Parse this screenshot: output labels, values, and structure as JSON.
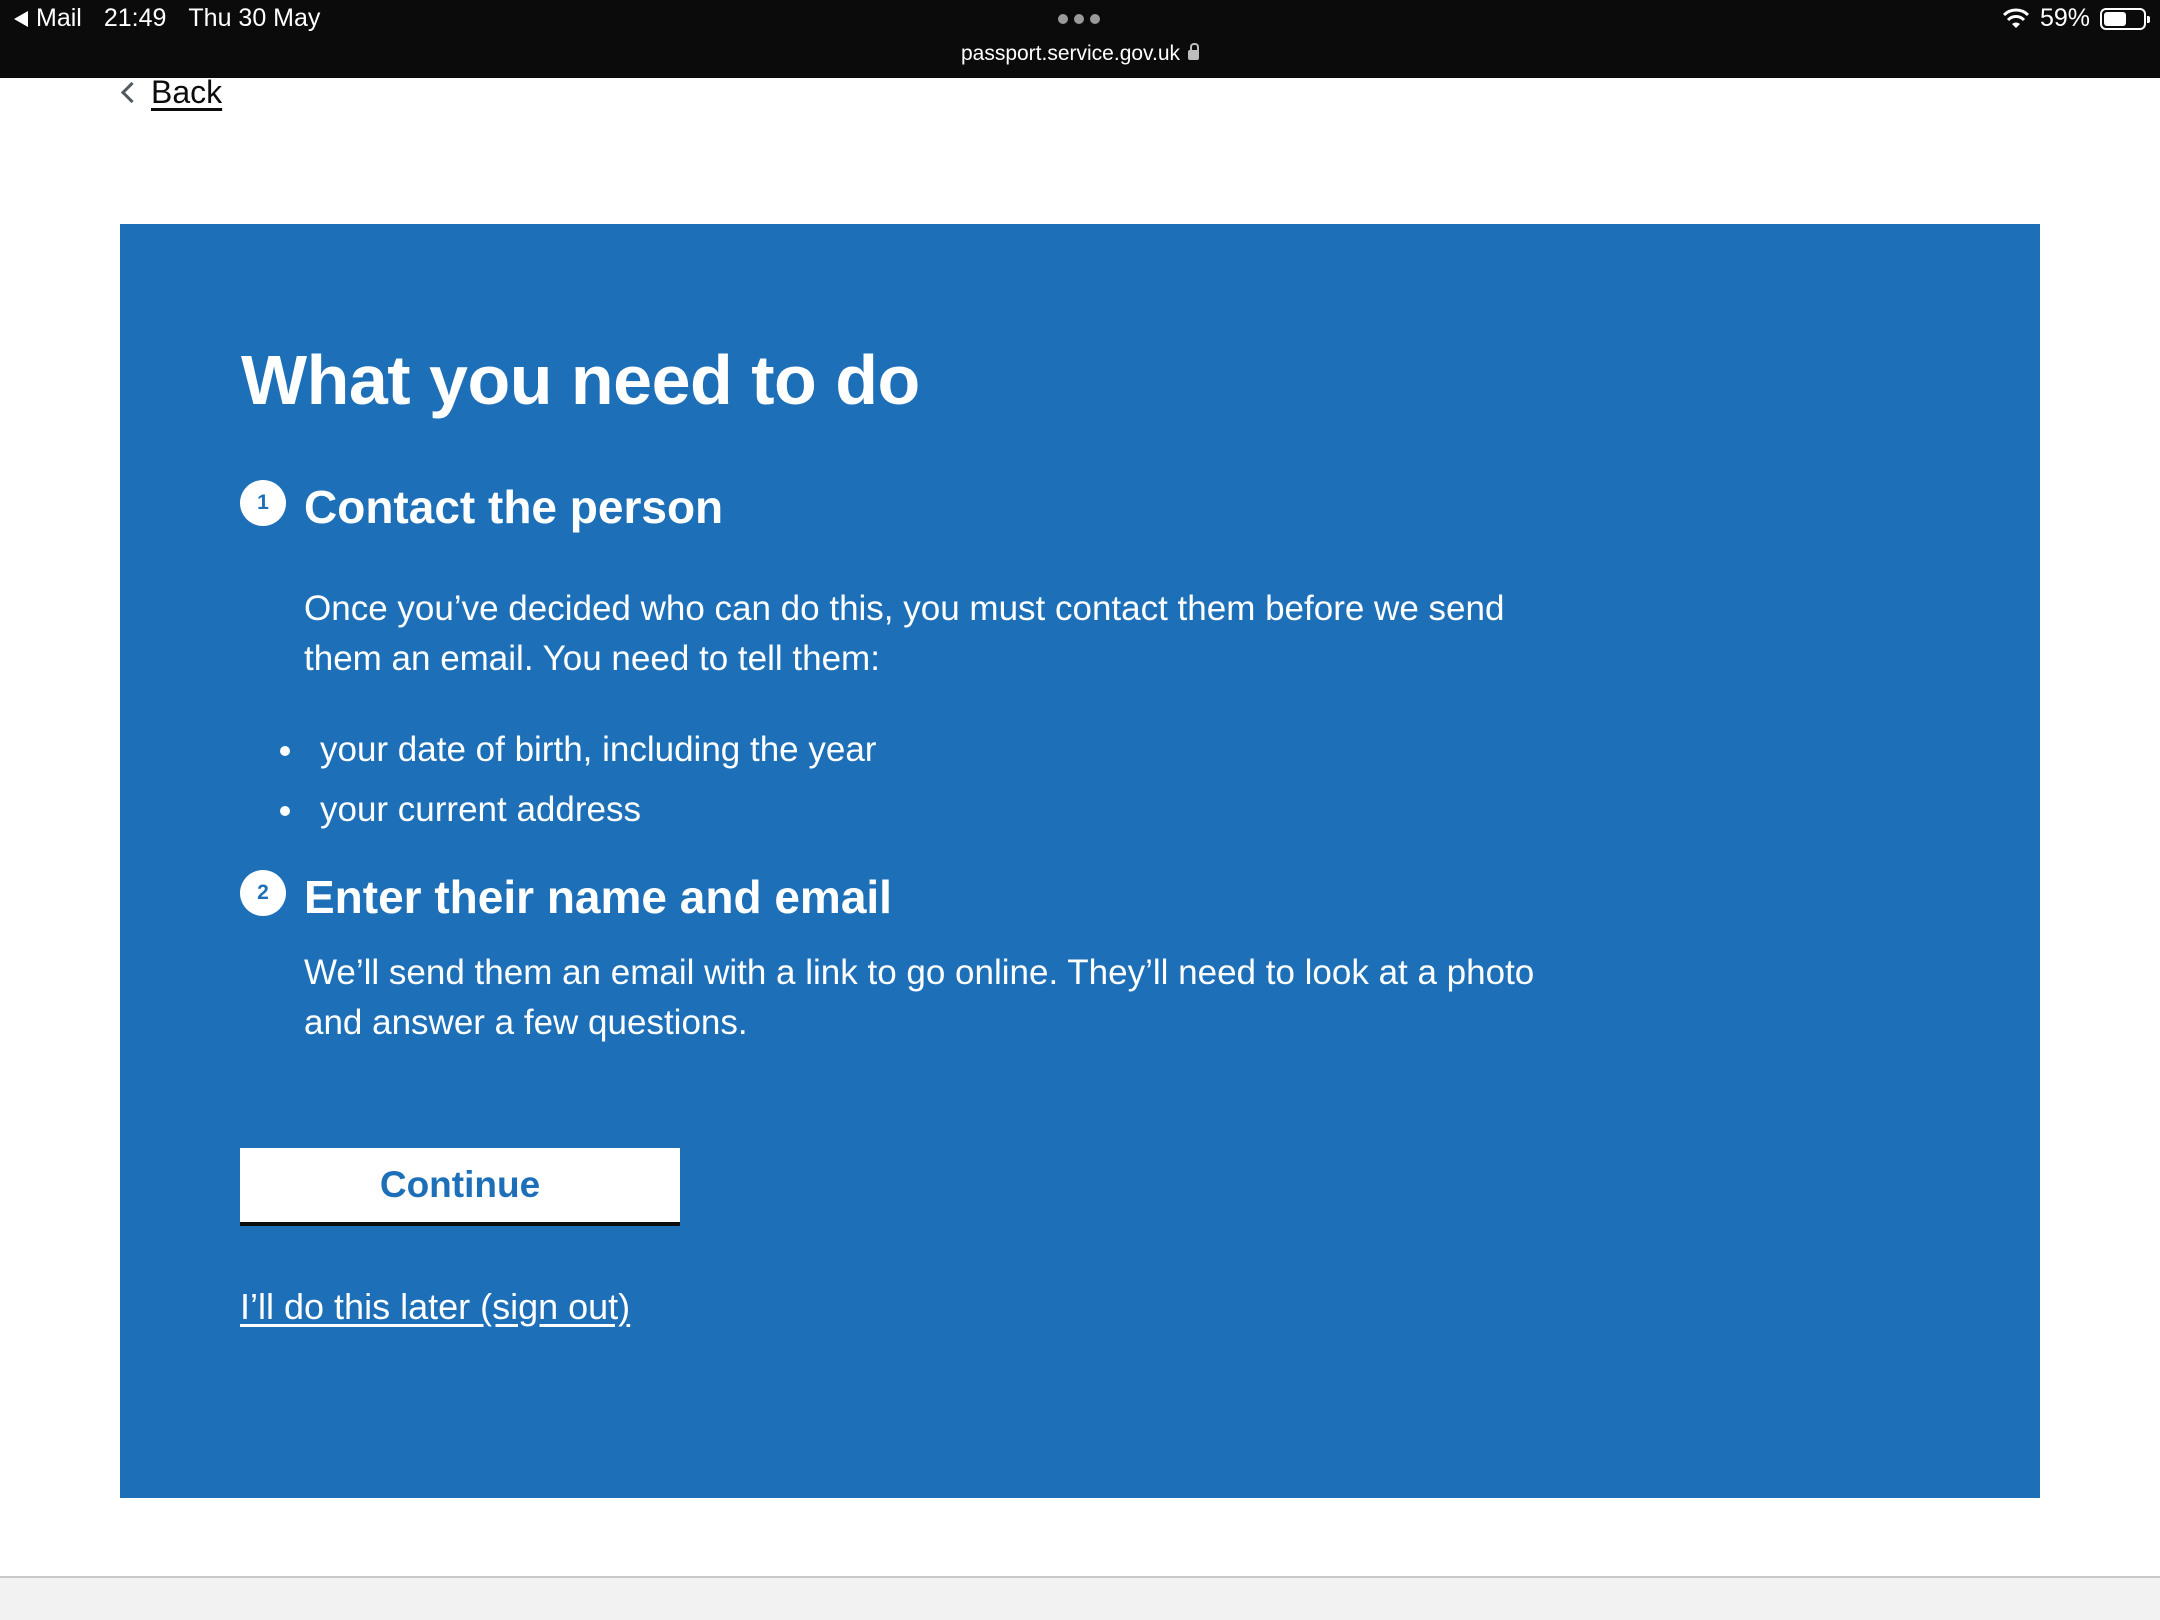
{
  "status_bar": {
    "back_app": "Mail",
    "time": "21:49",
    "date": "Thu 30 May",
    "url": "passport.service.gov.uk",
    "battery": "59%",
    "battery_level": 0.59
  },
  "nav": {
    "back_label": "Back"
  },
  "panel": {
    "title": "What you need to do",
    "steps": [
      {
        "number": "1",
        "heading": "Contact the person",
        "body": "Once you’ve decided who can do this, you must contact them before we send them an email. You need to tell them:",
        "bullets": [
          "your date of birth, including the year",
          "your current address"
        ]
      },
      {
        "number": "2",
        "heading": "Enter their name and email",
        "body": "We’ll send them an email with a link to go online. They’ll need to look at a photo and answer a few questions."
      }
    ],
    "continue_label": "Continue",
    "later_link": "I’ll do this later (sign out)"
  },
  "colors": {
    "panel_blue": "#1d70b8",
    "status_bar": "#0b0b0b",
    "text_dark": "#0b0c0c"
  }
}
